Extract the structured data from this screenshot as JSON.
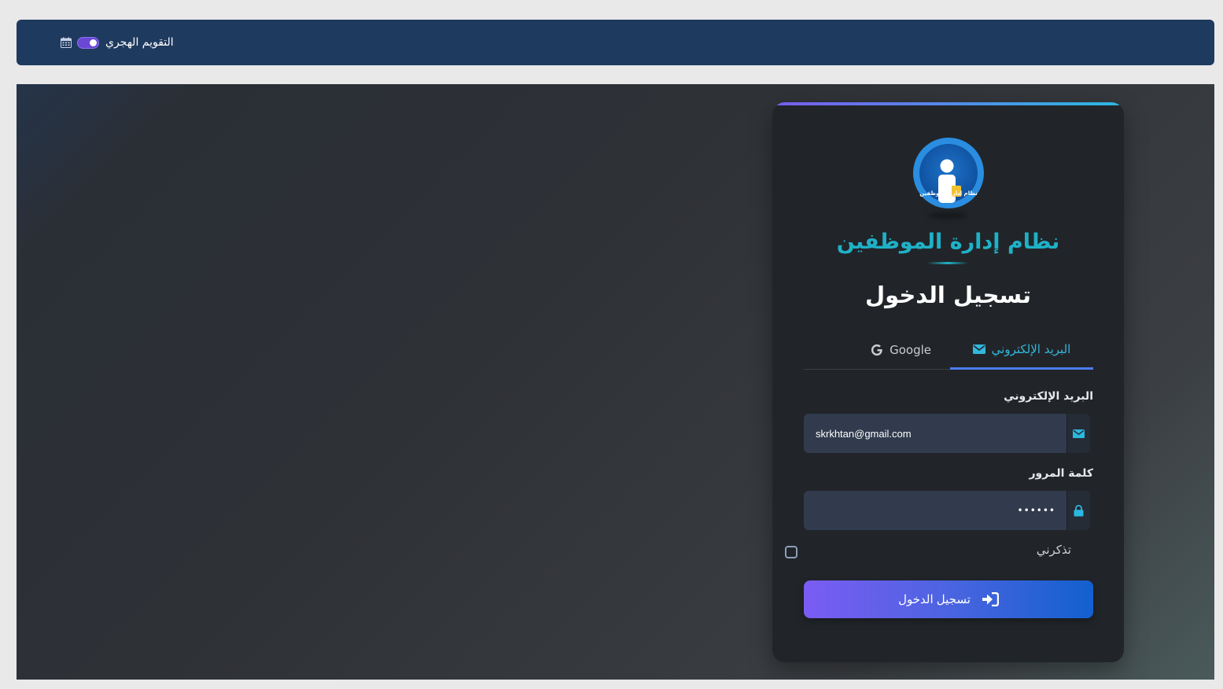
{
  "header": {
    "hijri_calendar_label": "التقويم الهجري",
    "hijri_calendar_enabled": true
  },
  "login_card": {
    "app_name": "نظام إدارة الموظفين",
    "logo_text": "نظام إدارة الموظفين",
    "title": "تسجيل الدخول",
    "tabs": [
      {
        "label": "البريد الإلكتروني",
        "icon": "envelope-icon",
        "active": true
      },
      {
        "label": "Google",
        "icon": "google-icon",
        "active": false
      }
    ],
    "email_label": "البريد الإلكتروني",
    "email_value": "skrkhtan@gmail.com",
    "password_label": "كلمة المرور",
    "password_masked": "••••••",
    "remember_me_label": "تذكرني",
    "remember_me_checked": false,
    "submit_label": "تسجيل الدخول"
  },
  "colors": {
    "header_bg": "#1f3a5f",
    "card_bg": "#212529",
    "accent": "#1fb1c7",
    "tab_active": "#33b7dd",
    "button_gradient_start": "#7b5cf4",
    "button_gradient_end": "#1260cf"
  }
}
